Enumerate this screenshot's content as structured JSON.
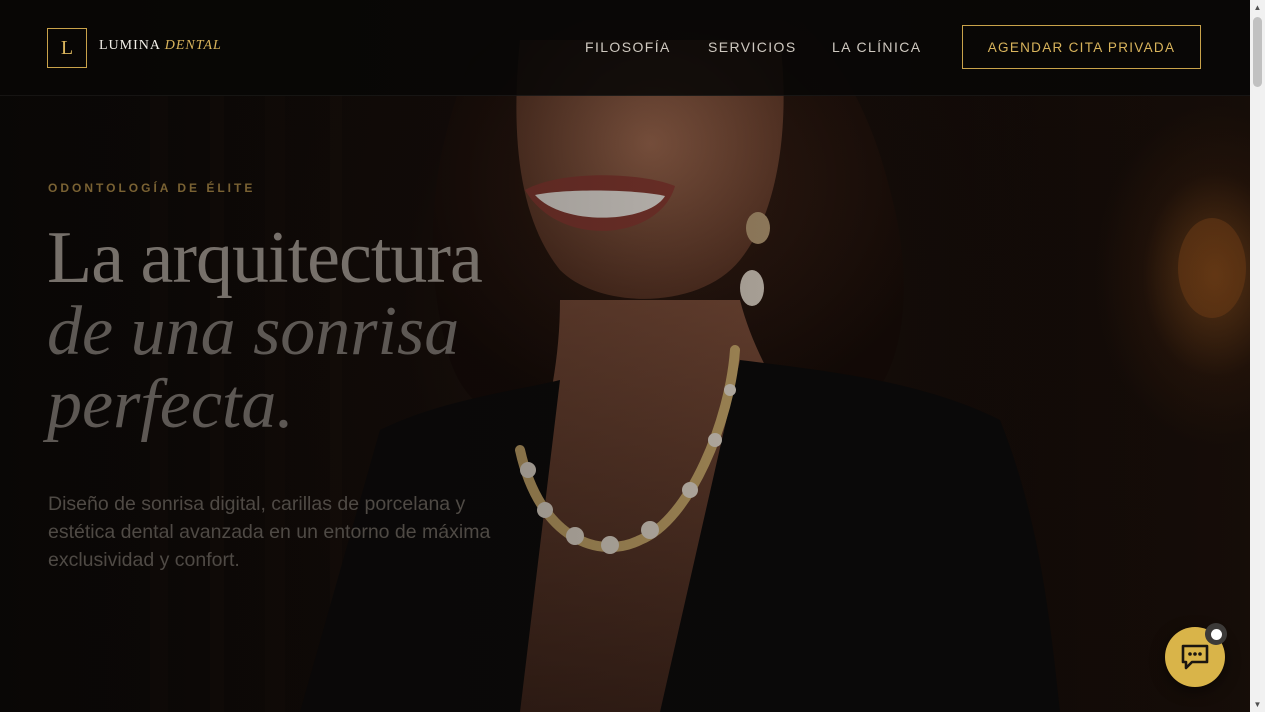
{
  "brand": {
    "mark": "L",
    "name": "LUMINA",
    "name_accent": "DENTAL"
  },
  "nav": {
    "links": [
      "FILOSOFÍA",
      "SERVICIOS",
      "LA CLÍNICA"
    ],
    "cta": "AGENDAR CITA PRIVADA"
  },
  "hero": {
    "eyebrow": "ODONTOLOGÍA DE ÉLITE",
    "headline_line1": "La arquitectura",
    "headline_line2": "de una sonrisa",
    "headline_line3": "perfecta.",
    "lede": "Diseño de sonrisa digital, carillas de porcelana y estética dental avanzada en un entorno de máxima exclusividad y confort."
  },
  "chat": {
    "icon": "chat-bubble-icon",
    "status": "online-dot"
  },
  "colors": {
    "accent_gold": "#c9a24a",
    "chat_gold": "#d9b449",
    "nav_bg": "#080706",
    "text_light": "#cfc9c0"
  }
}
